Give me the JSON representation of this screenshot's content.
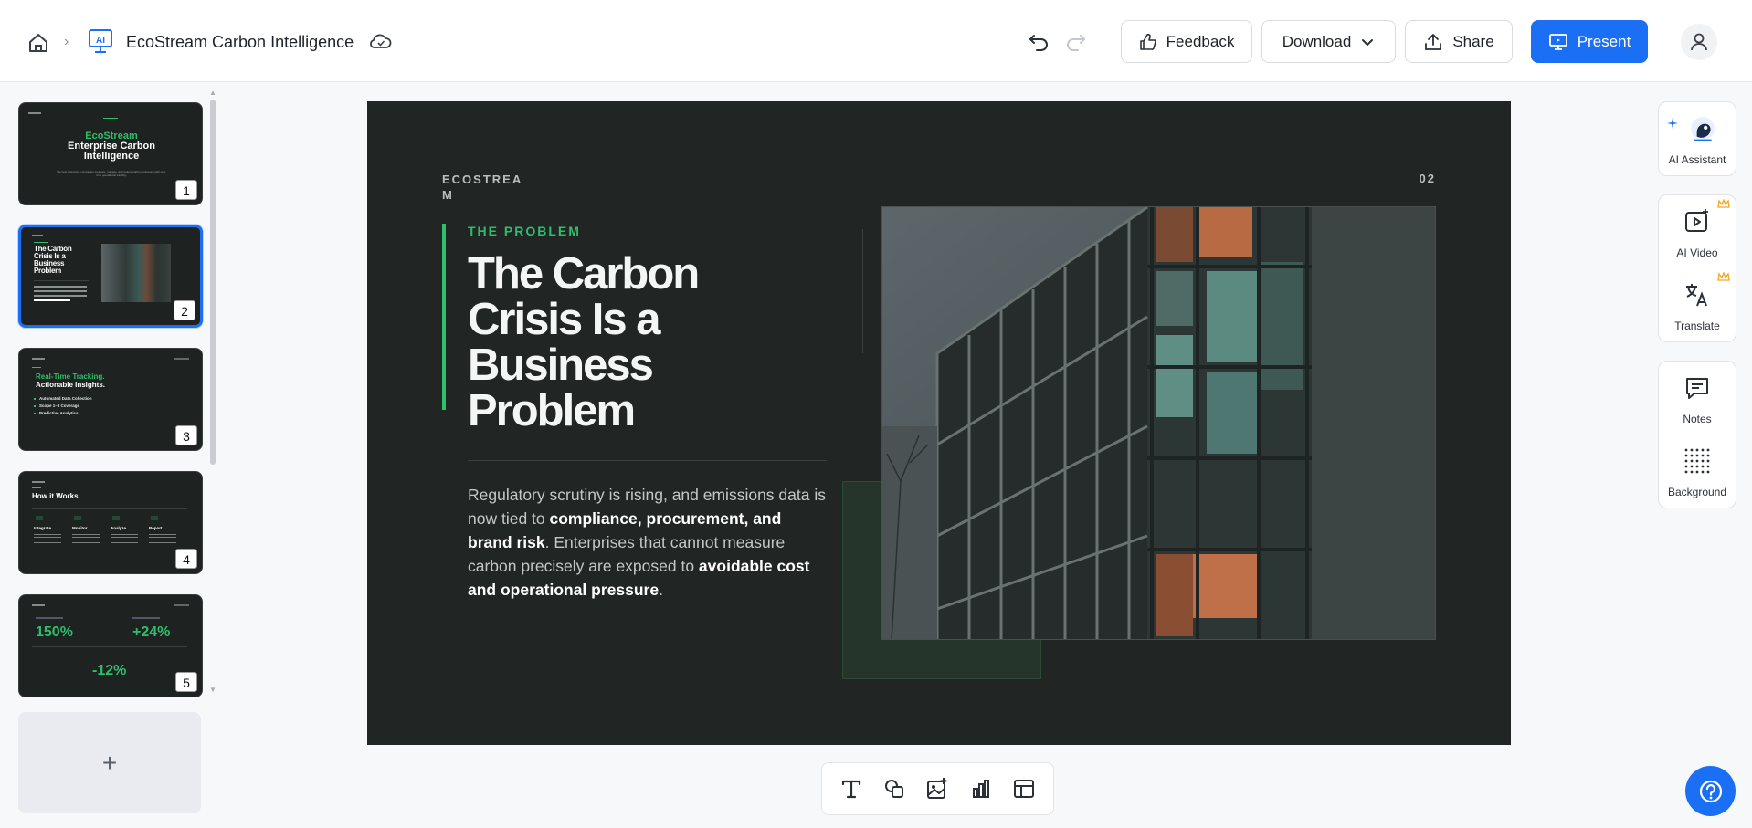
{
  "header": {
    "title": "EcoStream Carbon Intelligence",
    "breadcrumb_sep": "›",
    "app_icon_text": "AI",
    "feedback_label": "Feedback",
    "download_label": "Download",
    "share_label": "Share",
    "present_label": "Present"
  },
  "sidebar": {
    "slides": [
      {
        "num": "1",
        "brand": "EcoStream",
        "title": "Enterprise Carbon Intelligence",
        "subtitle": "We help enterprise companies measure, manage, and reduce carbon emissions with real-time operational visibility."
      },
      {
        "num": "2",
        "title": "The Carbon Crisis Is a Business Problem"
      },
      {
        "num": "3",
        "title_green": "Real-Time Tracking.",
        "title_white": "Actionable Insights.",
        "bullets": [
          "Automated Data Collection",
          "Scope 1–3 Coverage",
          "Predictive Analytics"
        ]
      },
      {
        "num": "4",
        "title": "How it Works",
        "steps": [
          "Integrate",
          "Monitor",
          "Analyze",
          "Report"
        ]
      },
      {
        "num": "5",
        "stats": [
          "150%",
          "+24%",
          "-12%"
        ]
      }
    ],
    "add_label": "+"
  },
  "slide": {
    "brand": "ECOSTREA M",
    "page": "02",
    "kicker": "THE PROBLEM",
    "title": "The Carbon Crisis Is a Business Problem",
    "body_1": "Regulatory scrutiny is rising, and emissions data is now tied to ",
    "body_bold_1": "compliance, procurement, and brand risk",
    "body_2": ". Enterprises that cannot measure carbon precisely are exposed to ",
    "body_bold_2": "avoidable cost and operational pressure",
    "body_3": "."
  },
  "right_panel": {
    "ai_assistant": "AI Assistant",
    "ai_video": "AI Video",
    "translate": "Translate",
    "notes": "Notes",
    "background": "Background"
  },
  "colors": {
    "accent": "#1a6ff5",
    "slide_bg": "#212524",
    "slide_green": "#2fbf6b"
  },
  "icons": [
    "home-icon",
    "ai-presentation-icon",
    "cloud-sync-icon",
    "undo-icon",
    "redo-icon",
    "thumbs-up-icon",
    "chevron-down-icon",
    "share-upload-icon",
    "present-icon",
    "user-icon",
    "text-tool-icon",
    "shapes-icon",
    "image-add-icon",
    "chart-icon",
    "table-icon",
    "ai-assistant-icon",
    "ai-video-icon",
    "translate-icon",
    "notes-icon",
    "background-grid-icon",
    "help-icon"
  ]
}
